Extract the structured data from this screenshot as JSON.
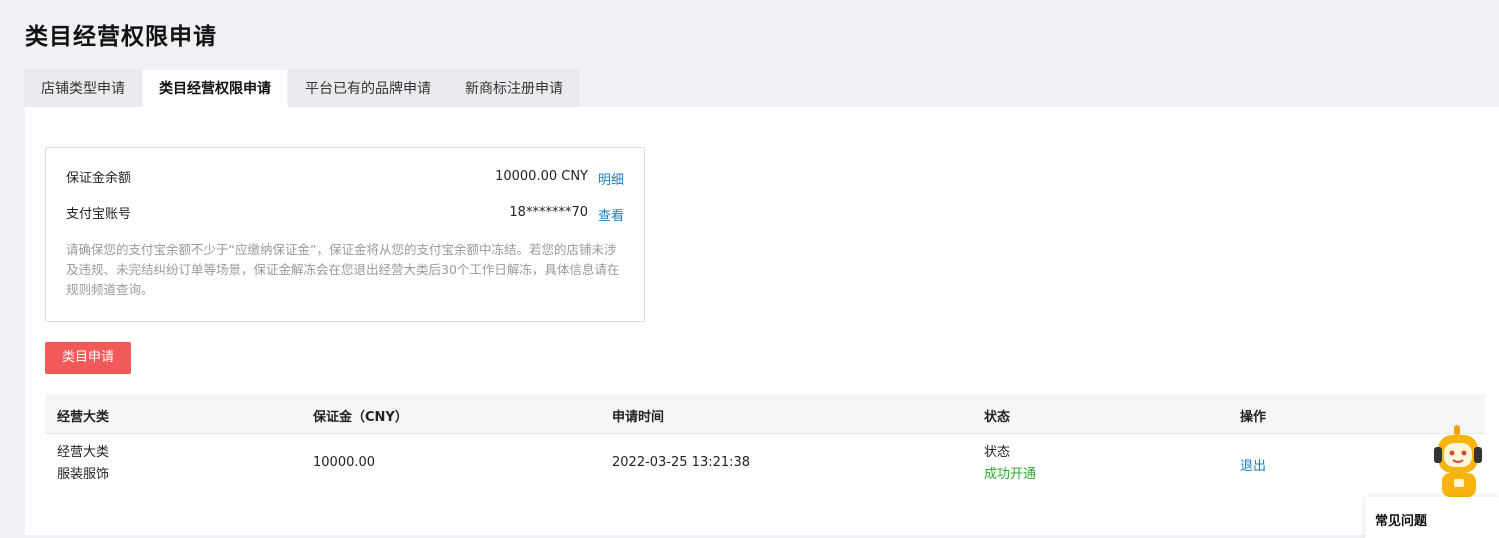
{
  "page_title": "类目经营权限申请",
  "tabs": [
    {
      "label": "店铺类型申请"
    },
    {
      "label": "类目经营权限申请"
    },
    {
      "label": "平台已有的品牌申请"
    },
    {
      "label": "新商标注册申请"
    }
  ],
  "deposit": {
    "balance_label": "保证金余额",
    "balance_value": "10000.00 CNY",
    "balance_link": "明细",
    "alipay_label": "支付宝账号",
    "alipay_value": "18*******70",
    "alipay_link": "查看",
    "note": "请确保您的支付宝余额不少于“应缴纳保证金”，保证金将从您的支付宝余额中冻结。若您的店铺未涉及违规、未完结纠纷订单等场景，保证金解冻会在您退出经营大类后30个工作日解冻，具体信息请在规则频道查询。"
  },
  "apply_button": "类目申请",
  "table": {
    "headers": [
      "经营大类",
      "保证金（CNY）",
      "申请时间",
      "状态",
      "操作"
    ],
    "rows": [
      {
        "category_title": "经营大类",
        "category_value": "服装服饰",
        "deposit": "10000.00",
        "time": "2022-03-25 13:21:38",
        "status_title": "状态",
        "status_value": "成功开通",
        "action": "退出"
      }
    ]
  },
  "faq_label": "常见问题",
  "colors": {
    "accent_link": "#1a7fc6",
    "apply_button": "#f25a5a",
    "success": "#2fa82f"
  },
  "icons": [
    "robot-assistant-icon"
  ]
}
